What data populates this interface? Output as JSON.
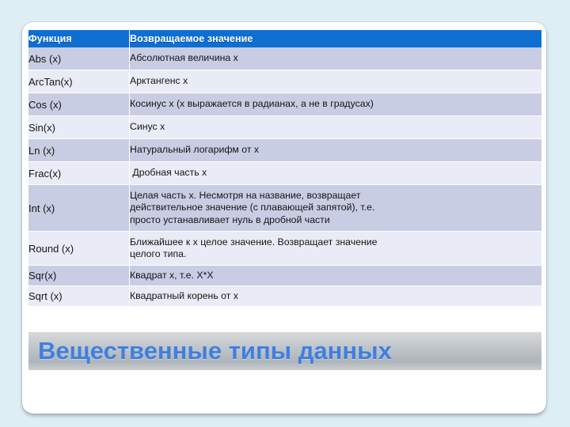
{
  "slide": {
    "title": "Вещественные типы данных",
    "background_color": "#ddeef4",
    "card_color": "#ffffff",
    "title_color": "#3f7fe0",
    "title_band_color": "#bfc4c8"
  },
  "table": {
    "header_bg": "#0e6fd1",
    "header_text_color": "#ffffff",
    "stripe_dark": "#c8cde3",
    "stripe_light": "#e9ecf6",
    "columns": [
      "Функция",
      "Возвращаемое значение"
    ],
    "rows": [
      {
        "function": "Abs (x)",
        "description_lines": [
          "Абсолютная величина x"
        ]
      },
      {
        "function": "ArcTan(x)",
        "description_lines": [
          "Арктангенс x"
        ]
      },
      {
        "function": "Cos (x)",
        "description_lines": [
          "Косинус x (x выражается в радианах, а не в градусах)"
        ]
      },
      {
        "function": "Sin(x)",
        "description_lines": [
          "Синус x"
        ]
      },
      {
        "function": "Ln (x)",
        "description_lines": [
          "Натуральный логарифм от x"
        ]
      },
      {
        "function": "Frac(x)",
        "description_lines": [
          " Дробная часть x"
        ]
      },
      {
        "function": "Int (x)",
        "description_lines": [
          "Целая часть x. Несмотря на название, возвращает",
          "действительное значение (с плавающей запятой), т.е.",
          "просто устанавливает нуль в дробной части"
        ]
      },
      {
        "function": "Round (x)",
        "description_lines": [
          "Ближайшее к x целое значение. Возвращает значение",
          "целого типа."
        ]
      },
      {
        "function": "Sqr(x)",
        "description_lines": [
          "Квадрат x, т.е. X*X"
        ]
      },
      {
        "function": "Sqrt (x)",
        "description_lines": [
          "Квадратный корень от x"
        ]
      }
    ]
  }
}
